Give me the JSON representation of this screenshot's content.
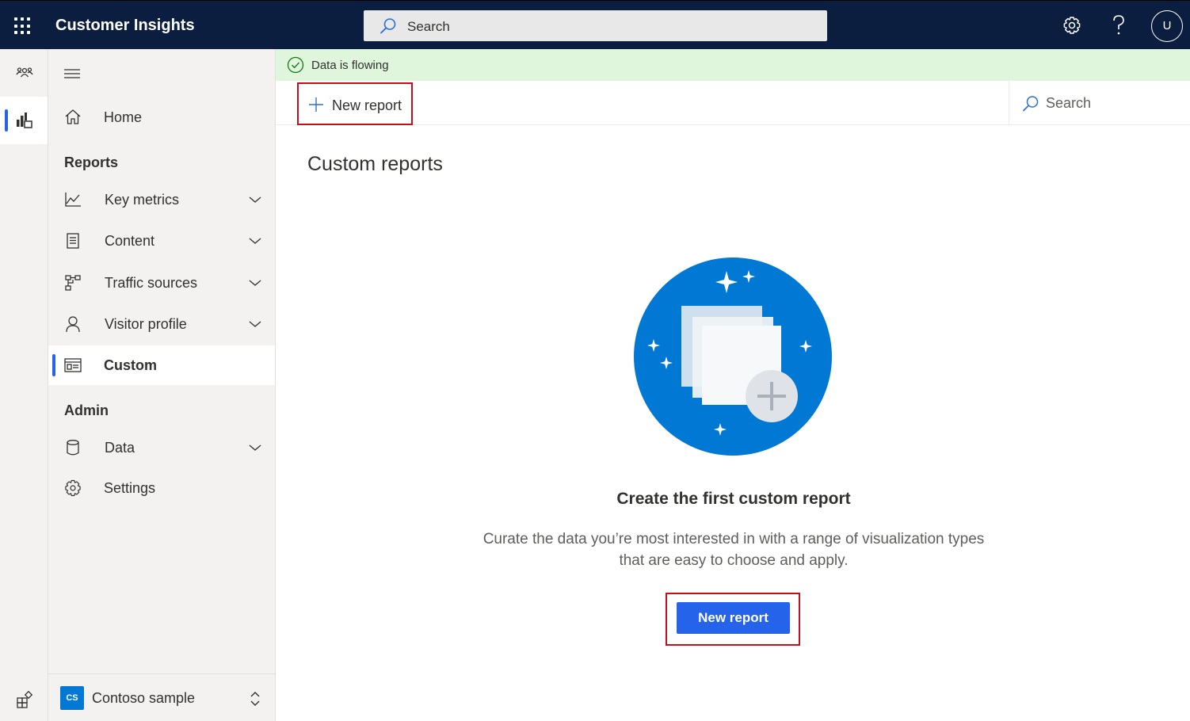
{
  "header": {
    "app_title": "Customer Insights",
    "search_placeholder": "Search",
    "user_initial": "U",
    "icons": [
      "waffle-icon",
      "search-icon",
      "gear-icon",
      "help-icon"
    ]
  },
  "rail": {
    "items": [
      {
        "name": "audience-icon",
        "active": false
      },
      {
        "name": "analytics-icon",
        "active": true
      },
      {
        "name": "app-switcher-icon",
        "active": false
      }
    ]
  },
  "nav": {
    "home": "Home",
    "reports_heading": "Reports",
    "reports": [
      {
        "label": "Key metrics",
        "icon": "line-chart-icon",
        "expandable": true
      },
      {
        "label": "Content",
        "icon": "document-icon",
        "expandable": true
      },
      {
        "label": "Traffic sources",
        "icon": "flow-icon",
        "expandable": true
      },
      {
        "label": "Visitor profile",
        "icon": "person-icon",
        "expandable": true
      },
      {
        "label": "Custom",
        "icon": "custom-report-icon",
        "expandable": false,
        "active": true
      }
    ],
    "admin_heading": "Admin",
    "admin": [
      {
        "label": "Data",
        "icon": "database-icon",
        "expandable": true
      },
      {
        "label": "Settings",
        "icon": "gear-icon",
        "expandable": false
      }
    ],
    "environment": {
      "badge": "CS",
      "label": "Contoso sample"
    }
  },
  "banner": {
    "text": "Data is flowing",
    "status_color": "#107c10"
  },
  "command_bar": {
    "new_report_label": "New report",
    "search_placeholder": "Search"
  },
  "main": {
    "title": "Custom reports",
    "empty_state": {
      "title": "Create the first custom report",
      "description": "Curate the data you’re most interested in with a range of visualization types that are easy to choose and apply.",
      "button_label": "New report"
    }
  },
  "colors": {
    "header_bg": "#0b1e3f",
    "accent": "#2563eb",
    "highlight_outline": "#c50f1f",
    "banner_bg": "#dff6dd",
    "illustration_blue": "#0078d4"
  }
}
